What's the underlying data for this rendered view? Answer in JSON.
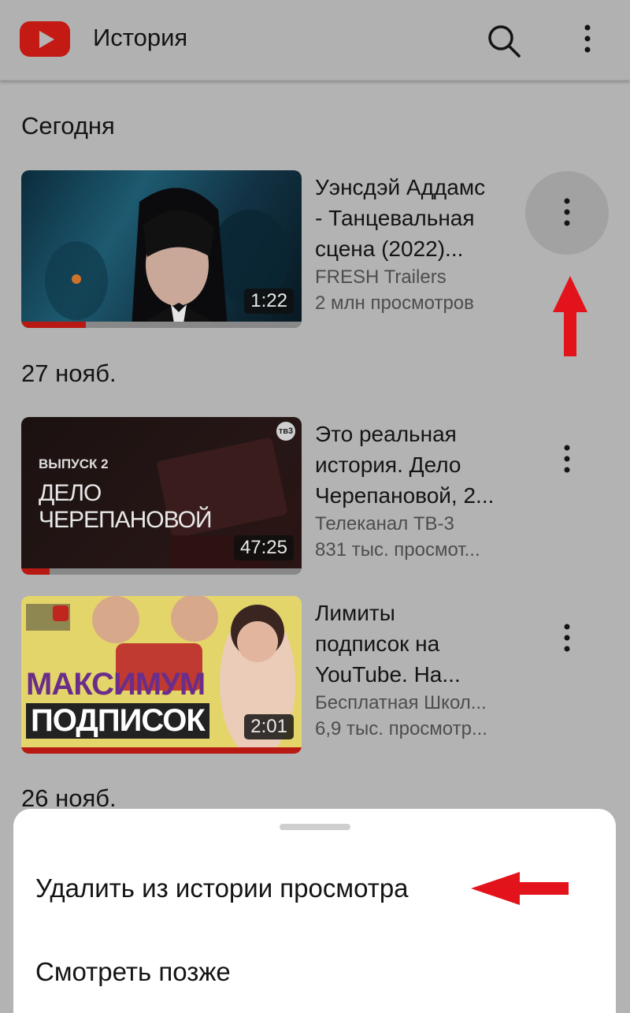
{
  "header": {
    "title": "История"
  },
  "sections": [
    {
      "label": "Сегодня"
    },
    {
      "label": "27 нояб."
    },
    {
      "label": "26 нояб."
    }
  ],
  "videos": [
    {
      "title_lines": [
        "Уэнсдэй Аддамс",
        "- Танцевальная",
        "сцена (2022)..."
      ],
      "channel": "FRESH Trailers",
      "views": "2 млн просмотров",
      "duration": "1:22",
      "progress_fraction": 0.23
    },
    {
      "title_lines": [
        "Это реальная",
        "история. Дело",
        "Черепановой, 2..."
      ],
      "channel": "Телеканал ТВ-3",
      "views": "831 тыс. просмот...",
      "duration": "47:25",
      "progress_fraction": 0.1,
      "thumb_text": {
        "episode": "ВЫПУСК 2",
        "line1": "ДЕЛО",
        "line2": "ЧЕРЕПАНОВОЙ",
        "logo": "тв3"
      }
    },
    {
      "title_lines": [
        "Лимиты",
        "подписок на",
        "YouTube. На..."
      ],
      "channel": "Бесплатная Школ...",
      "views": "6,9 тыс. просмотр...",
      "duration": "2:01",
      "progress_fraction": 1.0,
      "thumb_text": {
        "line1": "МАКСИМУМ",
        "line2": "ПОДПИСОК"
      }
    }
  ],
  "sheet": {
    "items": [
      "Удалить из истории просмотра",
      "Смотреть позже"
    ]
  },
  "colors": {
    "accent_red": "#e3131b",
    "youtube_red": "#c41a14"
  }
}
